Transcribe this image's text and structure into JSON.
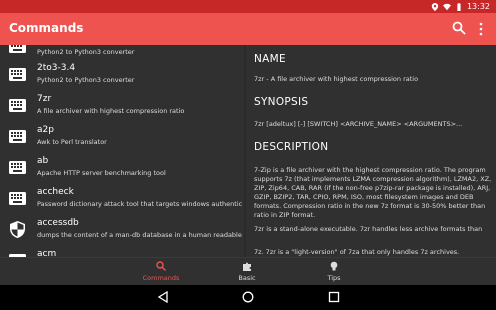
{
  "status_bar": {
    "time": "13:32"
  },
  "app_bar": {
    "title": "Commands"
  },
  "commands": [
    {
      "name": "",
      "desc": "Python2 to Python3 converter",
      "icon": "keyboard-icon"
    },
    {
      "name": "2to3-3.4",
      "desc": "Python2 to Python3 converter",
      "icon": "keyboard-icon"
    },
    {
      "name": "7zr",
      "desc": "A file archiver with highest compression ratio",
      "icon": "keyboard-icon"
    },
    {
      "name": "a2p",
      "desc": "Awk to Perl translator",
      "icon": "keyboard-icon"
    },
    {
      "name": "ab",
      "desc": "Apache HTTP server benchmarking tool",
      "icon": "keyboard-icon"
    },
    {
      "name": "accheck",
      "desc": "Password dictionary attack tool that targets windows authentication via...",
      "icon": "keyboard-icon"
    },
    {
      "name": "accessdb",
      "desc": "dumps the content of a man-db database in a human readable format",
      "icon": "shield-icon"
    },
    {
      "name": "acm",
      "desc": "",
      "icon": "keyboard-icon"
    }
  ],
  "detail": {
    "name_heading": "NAME",
    "name_text": "7zr - A file archiver with highest compression ratio",
    "synopsis_heading": "SYNOPSIS",
    "synopsis_text": "7zr [adeltux] [-] [SWITCH] <ARCHIVE_NAME> <ARGUMENTS>...",
    "description_heading": "DESCRIPTION",
    "description_text": "7-Zip is a file archiver with the highest compression ratio. The program supports 7z (that implements LZMA compression algorithm), LZMA2, XZ, ZIP, Zip64, CAB, RAR (if the non-free p7zip-rar package is installed), ARJ, GZIP, BZIP2, TAR, CPIO, RPM, ISO, most filesystem images and DEB formats. Compression ratio in the new 7z format is 30-50% better than ratio in ZIP format.",
    "para2": "7zr is a stand-alone executable. 7zr handles less archive formats than",
    "para3": "7z. 7zr is a \"light-version\" of 7za that only handles 7z archives."
  },
  "bottom_nav": {
    "tabs": [
      {
        "label": "Commands",
        "icon": "search-icon",
        "active": true
      },
      {
        "label": "Basic",
        "icon": "puzzle-icon",
        "active": false
      },
      {
        "label": "Tips",
        "icon": "lightbulb-icon",
        "active": false
      }
    ]
  },
  "colors": {
    "app_bar": "#ef5350",
    "status_bar": "#c62828",
    "background": "#303030",
    "accent": "#ef5350"
  }
}
